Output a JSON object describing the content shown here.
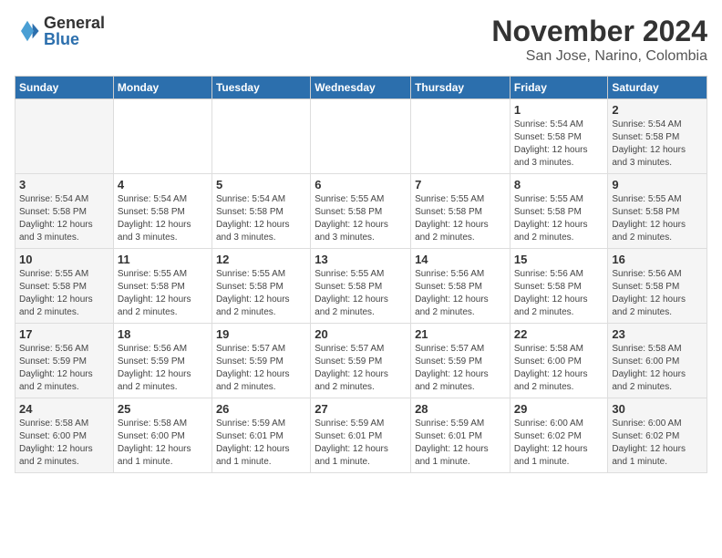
{
  "header": {
    "logo_general": "General",
    "logo_blue": "Blue",
    "month": "November 2024",
    "location": "San Jose, Narino, Colombia"
  },
  "weekdays": [
    "Sunday",
    "Monday",
    "Tuesday",
    "Wednesday",
    "Thursday",
    "Friday",
    "Saturday"
  ],
  "weeks": [
    [
      {
        "day": "",
        "info": ""
      },
      {
        "day": "",
        "info": ""
      },
      {
        "day": "",
        "info": ""
      },
      {
        "day": "",
        "info": ""
      },
      {
        "day": "",
        "info": ""
      },
      {
        "day": "1",
        "info": "Sunrise: 5:54 AM\nSunset: 5:58 PM\nDaylight: 12 hours\nand 3 minutes."
      },
      {
        "day": "2",
        "info": "Sunrise: 5:54 AM\nSunset: 5:58 PM\nDaylight: 12 hours\nand 3 minutes."
      }
    ],
    [
      {
        "day": "3",
        "info": "Sunrise: 5:54 AM\nSunset: 5:58 PM\nDaylight: 12 hours\nand 3 minutes."
      },
      {
        "day": "4",
        "info": "Sunrise: 5:54 AM\nSunset: 5:58 PM\nDaylight: 12 hours\nand 3 minutes."
      },
      {
        "day": "5",
        "info": "Sunrise: 5:54 AM\nSunset: 5:58 PM\nDaylight: 12 hours\nand 3 minutes."
      },
      {
        "day": "6",
        "info": "Sunrise: 5:55 AM\nSunset: 5:58 PM\nDaylight: 12 hours\nand 3 minutes."
      },
      {
        "day": "7",
        "info": "Sunrise: 5:55 AM\nSunset: 5:58 PM\nDaylight: 12 hours\nand 2 minutes."
      },
      {
        "day": "8",
        "info": "Sunrise: 5:55 AM\nSunset: 5:58 PM\nDaylight: 12 hours\nand 2 minutes."
      },
      {
        "day": "9",
        "info": "Sunrise: 5:55 AM\nSunset: 5:58 PM\nDaylight: 12 hours\nand 2 minutes."
      }
    ],
    [
      {
        "day": "10",
        "info": "Sunrise: 5:55 AM\nSunset: 5:58 PM\nDaylight: 12 hours\nand 2 minutes."
      },
      {
        "day": "11",
        "info": "Sunrise: 5:55 AM\nSunset: 5:58 PM\nDaylight: 12 hours\nand 2 minutes."
      },
      {
        "day": "12",
        "info": "Sunrise: 5:55 AM\nSunset: 5:58 PM\nDaylight: 12 hours\nand 2 minutes."
      },
      {
        "day": "13",
        "info": "Sunrise: 5:55 AM\nSunset: 5:58 PM\nDaylight: 12 hours\nand 2 minutes."
      },
      {
        "day": "14",
        "info": "Sunrise: 5:56 AM\nSunset: 5:58 PM\nDaylight: 12 hours\nand 2 minutes."
      },
      {
        "day": "15",
        "info": "Sunrise: 5:56 AM\nSunset: 5:58 PM\nDaylight: 12 hours\nand 2 minutes."
      },
      {
        "day": "16",
        "info": "Sunrise: 5:56 AM\nSunset: 5:58 PM\nDaylight: 12 hours\nand 2 minutes."
      }
    ],
    [
      {
        "day": "17",
        "info": "Sunrise: 5:56 AM\nSunset: 5:59 PM\nDaylight: 12 hours\nand 2 minutes."
      },
      {
        "day": "18",
        "info": "Sunrise: 5:56 AM\nSunset: 5:59 PM\nDaylight: 12 hours\nand 2 minutes."
      },
      {
        "day": "19",
        "info": "Sunrise: 5:57 AM\nSunset: 5:59 PM\nDaylight: 12 hours\nand 2 minutes."
      },
      {
        "day": "20",
        "info": "Sunrise: 5:57 AM\nSunset: 5:59 PM\nDaylight: 12 hours\nand 2 minutes."
      },
      {
        "day": "21",
        "info": "Sunrise: 5:57 AM\nSunset: 5:59 PM\nDaylight: 12 hours\nand 2 minutes."
      },
      {
        "day": "22",
        "info": "Sunrise: 5:58 AM\nSunset: 6:00 PM\nDaylight: 12 hours\nand 2 minutes."
      },
      {
        "day": "23",
        "info": "Sunrise: 5:58 AM\nSunset: 6:00 PM\nDaylight: 12 hours\nand 2 minutes."
      }
    ],
    [
      {
        "day": "24",
        "info": "Sunrise: 5:58 AM\nSunset: 6:00 PM\nDaylight: 12 hours\nand 2 minutes."
      },
      {
        "day": "25",
        "info": "Sunrise: 5:58 AM\nSunset: 6:00 PM\nDaylight: 12 hours\nand 1 minute."
      },
      {
        "day": "26",
        "info": "Sunrise: 5:59 AM\nSunset: 6:01 PM\nDaylight: 12 hours\nand 1 minute."
      },
      {
        "day": "27",
        "info": "Sunrise: 5:59 AM\nSunset: 6:01 PM\nDaylight: 12 hours\nand 1 minute."
      },
      {
        "day": "28",
        "info": "Sunrise: 5:59 AM\nSunset: 6:01 PM\nDaylight: 12 hours\nand 1 minute."
      },
      {
        "day": "29",
        "info": "Sunrise: 6:00 AM\nSunset: 6:02 PM\nDaylight: 12 hours\nand 1 minute."
      },
      {
        "day": "30",
        "info": "Sunrise: 6:00 AM\nSunset: 6:02 PM\nDaylight: 12 hours\nand 1 minute."
      }
    ]
  ]
}
